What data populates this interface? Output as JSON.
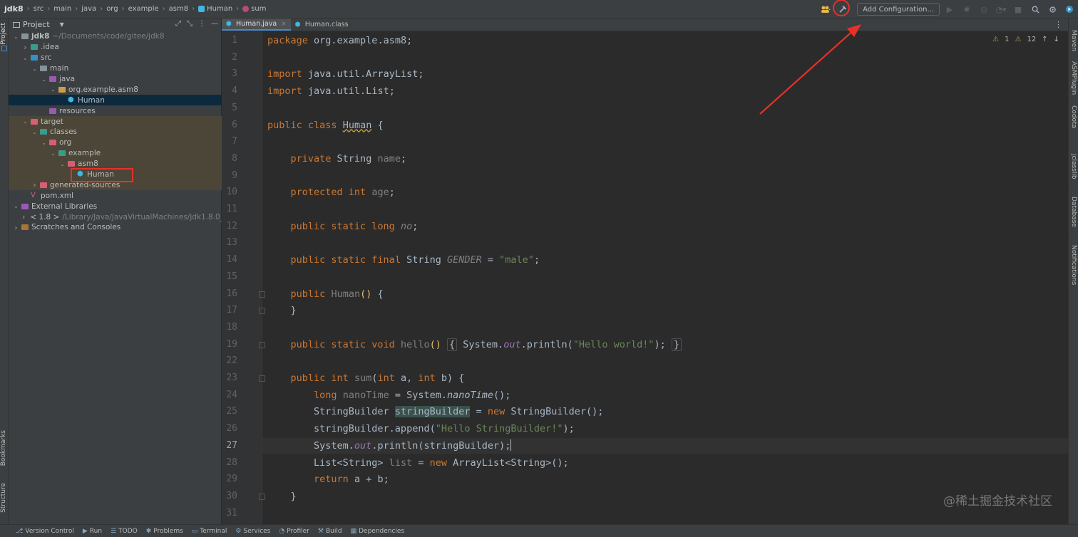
{
  "breadcrumbs": [
    {
      "label": "jdk8",
      "icon": "project-icon"
    },
    {
      "label": "src",
      "icon": "folder-icon"
    },
    {
      "label": "main",
      "icon": "folder-icon"
    },
    {
      "label": "java",
      "icon": "folder-icon"
    },
    {
      "label": "org",
      "icon": "folder-icon"
    },
    {
      "label": "example",
      "icon": "folder-icon"
    },
    {
      "label": "asm8",
      "icon": "folder-icon"
    },
    {
      "label": "Human",
      "icon": "class-icon"
    },
    {
      "label": "sum",
      "icon": "method-icon"
    }
  ],
  "toolbar": {
    "add_config_label": "Add Configuration..."
  },
  "project_panel": {
    "title": "Project",
    "tree": [
      {
        "label": "jdk8",
        "suffix": "~/Documents/code/gitee/jdk8",
        "depth": 0,
        "expanded": true,
        "icon": "folder-icon",
        "color": "gray",
        "bold": true
      },
      {
        "label": ".idea",
        "depth": 1,
        "expanded": false,
        "icon": "folder-icon",
        "color": "teal"
      },
      {
        "label": "src",
        "depth": 1,
        "expanded": true,
        "icon": "folder-icon",
        "color": "blue"
      },
      {
        "label": "main",
        "depth": 2,
        "expanded": true,
        "icon": "folder-icon",
        "color": "gray"
      },
      {
        "label": "java",
        "depth": 3,
        "expanded": true,
        "icon": "folder-icon",
        "color": "purple"
      },
      {
        "label": "org.example.asm8",
        "depth": 4,
        "expanded": true,
        "icon": "package-icon",
        "color": "yellow"
      },
      {
        "label": "Human",
        "depth": 5,
        "icon": "class-icon",
        "selected": true
      },
      {
        "label": "resources",
        "depth": 3,
        "icon": "folder-icon",
        "color": "purple"
      },
      {
        "label": "target",
        "depth": 1,
        "expanded": true,
        "icon": "folder-icon",
        "color": "pink",
        "excluded": true
      },
      {
        "label": "classes",
        "depth": 2,
        "expanded": true,
        "icon": "folder-icon",
        "color": "teal",
        "excluded": true
      },
      {
        "label": "org",
        "depth": 3,
        "expanded": true,
        "icon": "folder-icon",
        "color": "pink",
        "excluded": true
      },
      {
        "label": "example",
        "depth": 4,
        "expanded": true,
        "icon": "folder-icon",
        "color": "teal",
        "excluded": true
      },
      {
        "label": "asm8",
        "depth": 5,
        "expanded": true,
        "icon": "folder-icon",
        "color": "pink",
        "excluded": true
      },
      {
        "label": "Human",
        "depth": 6,
        "icon": "class-icon",
        "excluded": true,
        "highlighted": true
      },
      {
        "label": "generated-sources",
        "depth": 2,
        "expanded": false,
        "icon": "folder-icon",
        "color": "pink",
        "excluded": true
      },
      {
        "label": "pom.xml",
        "depth": 1,
        "icon": "maven-icon"
      },
      {
        "label": "External Libraries",
        "depth": 0,
        "expanded": true,
        "icon": "library-icon",
        "color": "purple"
      },
      {
        "label": "< 1.8 >",
        "suffix": "/Library/Java/JavaVirtualMachines/jdk1.8.0_",
        "depth": 1,
        "expanded": false,
        "icon": "jdk-icon",
        "color": "gray"
      },
      {
        "label": "Scratches and Consoles",
        "depth": 0,
        "expanded": false,
        "icon": "scratches-icon",
        "color": "brown"
      }
    ]
  },
  "tabs": [
    {
      "label": "Human.java",
      "active": true
    },
    {
      "label": "Human.class",
      "active": false
    }
  ],
  "inspections": {
    "warnings": "1",
    "weak_warnings": "12"
  },
  "editor": {
    "current_line": "27",
    "lines": [
      {
        "n": "1",
        "html": "<span class=\"kw\">package</span> org.example.asm8;"
      },
      {
        "n": "2",
        "html": ""
      },
      {
        "n": "3",
        "html": "<span class=\"kw\">import</span> java.util.ArrayList;"
      },
      {
        "n": "4",
        "html": "<span class=\"kw\">import</span> java.util.List;"
      },
      {
        "n": "5",
        "html": ""
      },
      {
        "n": "6",
        "html": "<span class=\"kw\">public class</span> <span class=\"squiggle\">Human</span> {"
      },
      {
        "n": "7",
        "html": ""
      },
      {
        "n": "8",
        "html": "    <span class=\"kw\">private</span> String <span class=\"unused\">name</span>;"
      },
      {
        "n": "9",
        "html": ""
      },
      {
        "n": "10",
        "html": "    <span class=\"kw\">protected int</span> <span class=\"unused\">age</span>;"
      },
      {
        "n": "11",
        "html": ""
      },
      {
        "n": "12",
        "html": "    <span class=\"kw\">public static long</span> <span class=\"unused ital\">no</span>;"
      },
      {
        "n": "13",
        "html": ""
      },
      {
        "n": "14",
        "html": "    <span class=\"kw\">public static final</span> String <span class=\"unused ital\">GENDER</span> = <span class=\"str\">\"male\"</span>;"
      },
      {
        "n": "15",
        "html": ""
      },
      {
        "n": "16",
        "html": "    <span class=\"kw\">public</span> <span class=\"unused\">Human</span><span class=\"paren\">()</span> {"
      },
      {
        "n": "17",
        "html": "    }"
      },
      {
        "n": "18",
        "html": ""
      },
      {
        "n": "19",
        "html": "    <span class=\"kw\">public static void</span> <span class=\"unused\">hello</span><span class=\"paren\">()</span> <span class=\"folded\">{</span> System.<span class=\"fld ital\">out</span>.println(<span class=\"str\">\"Hello world!\"</span>); <span class=\"folded\">}</span>"
      },
      {
        "n": "22",
        "html": ""
      },
      {
        "n": "23",
        "html": "    <span class=\"kw\">public int</span> <span class=\"unused\">sum</span>(<span class=\"kw\">int</span> a, <span class=\"kw\">int</span> b) {"
      },
      {
        "n": "24",
        "html": "        <span class=\"kw\">long</span> <span class=\"unused\">nanoTime</span> = System.<span class=\"ital\">nanoTime</span>();"
      },
      {
        "n": "25",
        "html": "        StringBuilder <span class=\"hlvar\">stringBuilder</span> = <span class=\"kw\">new</span> StringBuilder();"
      },
      {
        "n": "26",
        "html": "        stringBuilder.append(<span class=\"str\">\"Hello StringBuilder!\"</span>);"
      },
      {
        "n": "27",
        "html": "        System.<span class=\"fld ital\">out</span>.println(stringBuilder);<span class=\"caret\"></span>"
      },
      {
        "n": "28",
        "html": "        List&lt;String&gt; <span class=\"unused\">list</span> = <span class=\"kw\">new</span> ArrayList&lt;String&gt;();"
      },
      {
        "n": "29",
        "html": "        <span class=\"kw\">return</span> a + b;"
      },
      {
        "n": "30",
        "html": "    }"
      },
      {
        "n": "31",
        "html": ""
      }
    ]
  },
  "left_strip": {
    "top": "Project",
    "bottom1": "Bookmarks",
    "bottom2": "Structure"
  },
  "right_strip": [
    "Maven",
    "ASMPlugin",
    "Codota",
    "jclasslib",
    "Database",
    "Notifications"
  ],
  "bottom_bar": [
    {
      "label": "Version Control",
      "icon": "vcs-icon"
    },
    {
      "label": "Run",
      "icon": "run-icon"
    },
    {
      "label": "TODO",
      "icon": "todo-icon"
    },
    {
      "label": "Problems",
      "icon": "problems-icon"
    },
    {
      "label": "Terminal",
      "icon": "terminal-icon"
    },
    {
      "label": "Services",
      "icon": "services-icon"
    },
    {
      "label": "Profiler",
      "icon": "profiler-icon"
    },
    {
      "label": "Build",
      "icon": "build-icon"
    },
    {
      "label": "Dependencies",
      "icon": "dependencies-icon"
    }
  ],
  "watermark": "@稀土掘金技术社区",
  "colors": {
    "accent": "#4a88c7",
    "annotation": "#e8302b",
    "keyword": "#cc7832",
    "string": "#6a8759"
  }
}
